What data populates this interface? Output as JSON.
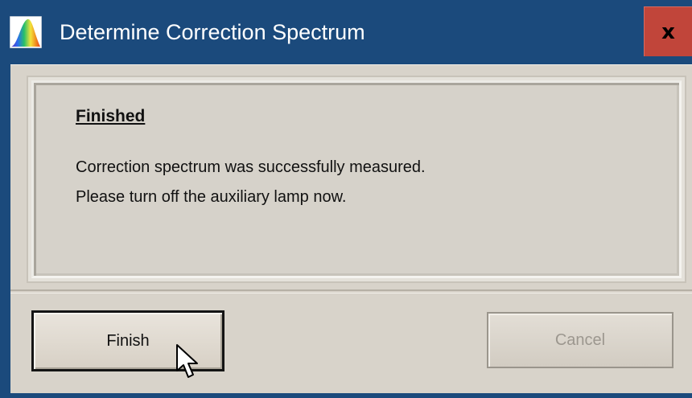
{
  "window": {
    "title": "Determine Correction Spectrum",
    "close_label": "x",
    "app_icon": "spectrum-app-icon"
  },
  "message": {
    "heading": "Finished",
    "line1": "Correction spectrum was successfully measured.",
    "line2": "Please turn off the auxiliary lamp now."
  },
  "buttons": {
    "finish_label": "Finish",
    "cancel_label": "Cancel",
    "cancel_disabled": true
  },
  "colors": {
    "titlebar": "#1b4a7c",
    "close_button": "#c1453a",
    "dialog_background": "#d8d3ca"
  }
}
